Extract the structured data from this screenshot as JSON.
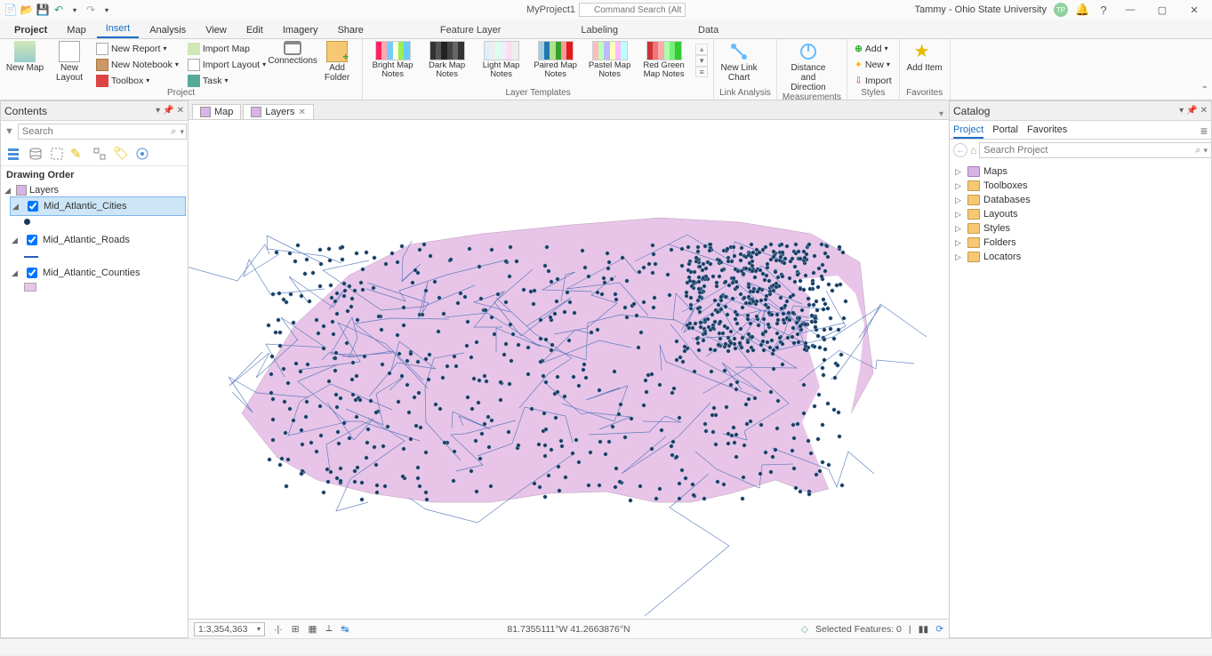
{
  "app": {
    "project_name": "MyProject1",
    "command_search_placeholder": "Command Search (Alt+Q)",
    "user_name": "Tammy - Ohio State University",
    "user_initials": "TP"
  },
  "tabs": {
    "items": [
      "Project",
      "Map",
      "Insert",
      "Analysis",
      "View",
      "Edit",
      "Imagery",
      "Share"
    ],
    "active": "Insert",
    "context_tabs": [
      "Feature Layer",
      "Labeling",
      "Data"
    ]
  },
  "ribbon": {
    "project_group": {
      "label": "Project",
      "new_map": "New\nMap",
      "new_layout": "New\nLayout",
      "new_report": "New Report",
      "new_notebook": "New Notebook",
      "toolbox": "Toolbox",
      "import_map": "Import Map",
      "import_layout": "Import Layout",
      "task": "Task",
      "connections": "Connections",
      "add_folder": "Add\nFolder"
    },
    "templates": {
      "label": "Layer Templates",
      "items": [
        {
          "name": "Bright\nMap Notes",
          "c": [
            "#f26",
            "#faa",
            "#7cf",
            "#ffd",
            "#9e5",
            "#6cf"
          ]
        },
        {
          "name": "Dark Map\nNotes",
          "c": [
            "#333",
            "#555",
            "#222",
            "#444",
            "#666",
            "#333"
          ]
        },
        {
          "name": "Light Map\nNotes",
          "c": [
            "#def",
            "#eee",
            "#dfe",
            "#eef",
            "#fde",
            "#eee"
          ]
        },
        {
          "name": "Paired\nMap Notes",
          "c": [
            "#a6cee3",
            "#1f78b4",
            "#b2df8a",
            "#33a02c",
            "#fb9a99",
            "#e31a1c"
          ]
        },
        {
          "name": "Pastel Map\nNotes",
          "c": [
            "#fbb",
            "#bfb",
            "#bbf",
            "#ffb",
            "#fbf",
            "#bff"
          ]
        },
        {
          "name": "Red Green\nMap Notes",
          "c": [
            "#c33",
            "#e77",
            "#faa",
            "#afa",
            "#7e7",
            "#3c3"
          ]
        }
      ]
    },
    "link": {
      "label": "Link Analysis",
      "btn": "New Link\nChart"
    },
    "meas": {
      "label": "Measurements",
      "btn": "Distance and\nDirection"
    },
    "styles": {
      "label": "Styles",
      "add": "Add",
      "new": "New",
      "import": "Import"
    },
    "fav": {
      "label": "Favorites",
      "btn": "Add\nItem"
    }
  },
  "contents": {
    "title": "Contents",
    "search_placeholder": "Search",
    "drawing_order": "Drawing Order",
    "root": "Layers",
    "layers": [
      {
        "name": "Mid_Atlantic_Cities",
        "selected": true,
        "sym": "point"
      },
      {
        "name": "Mid_Atlantic_Roads",
        "selected": false,
        "sym": "line"
      },
      {
        "name": "Mid_Atlantic_Counties",
        "selected": false,
        "sym": "poly"
      }
    ]
  },
  "view_tabs": [
    {
      "label": "Map",
      "closable": false
    },
    {
      "label": "Layers",
      "closable": true
    }
  ],
  "status": {
    "scale": "1:3,354,363",
    "coords": "81.7355111°W 41.2663876°N",
    "selected": "Selected Features: 0"
  },
  "catalog": {
    "title": "Catalog",
    "tabs": [
      "Project",
      "Portal",
      "Favorites"
    ],
    "active": "Project",
    "search_placeholder": "Search Project",
    "items": [
      "Maps",
      "Toolboxes",
      "Databases",
      "Layouts",
      "Styles",
      "Folders",
      "Locators"
    ]
  }
}
